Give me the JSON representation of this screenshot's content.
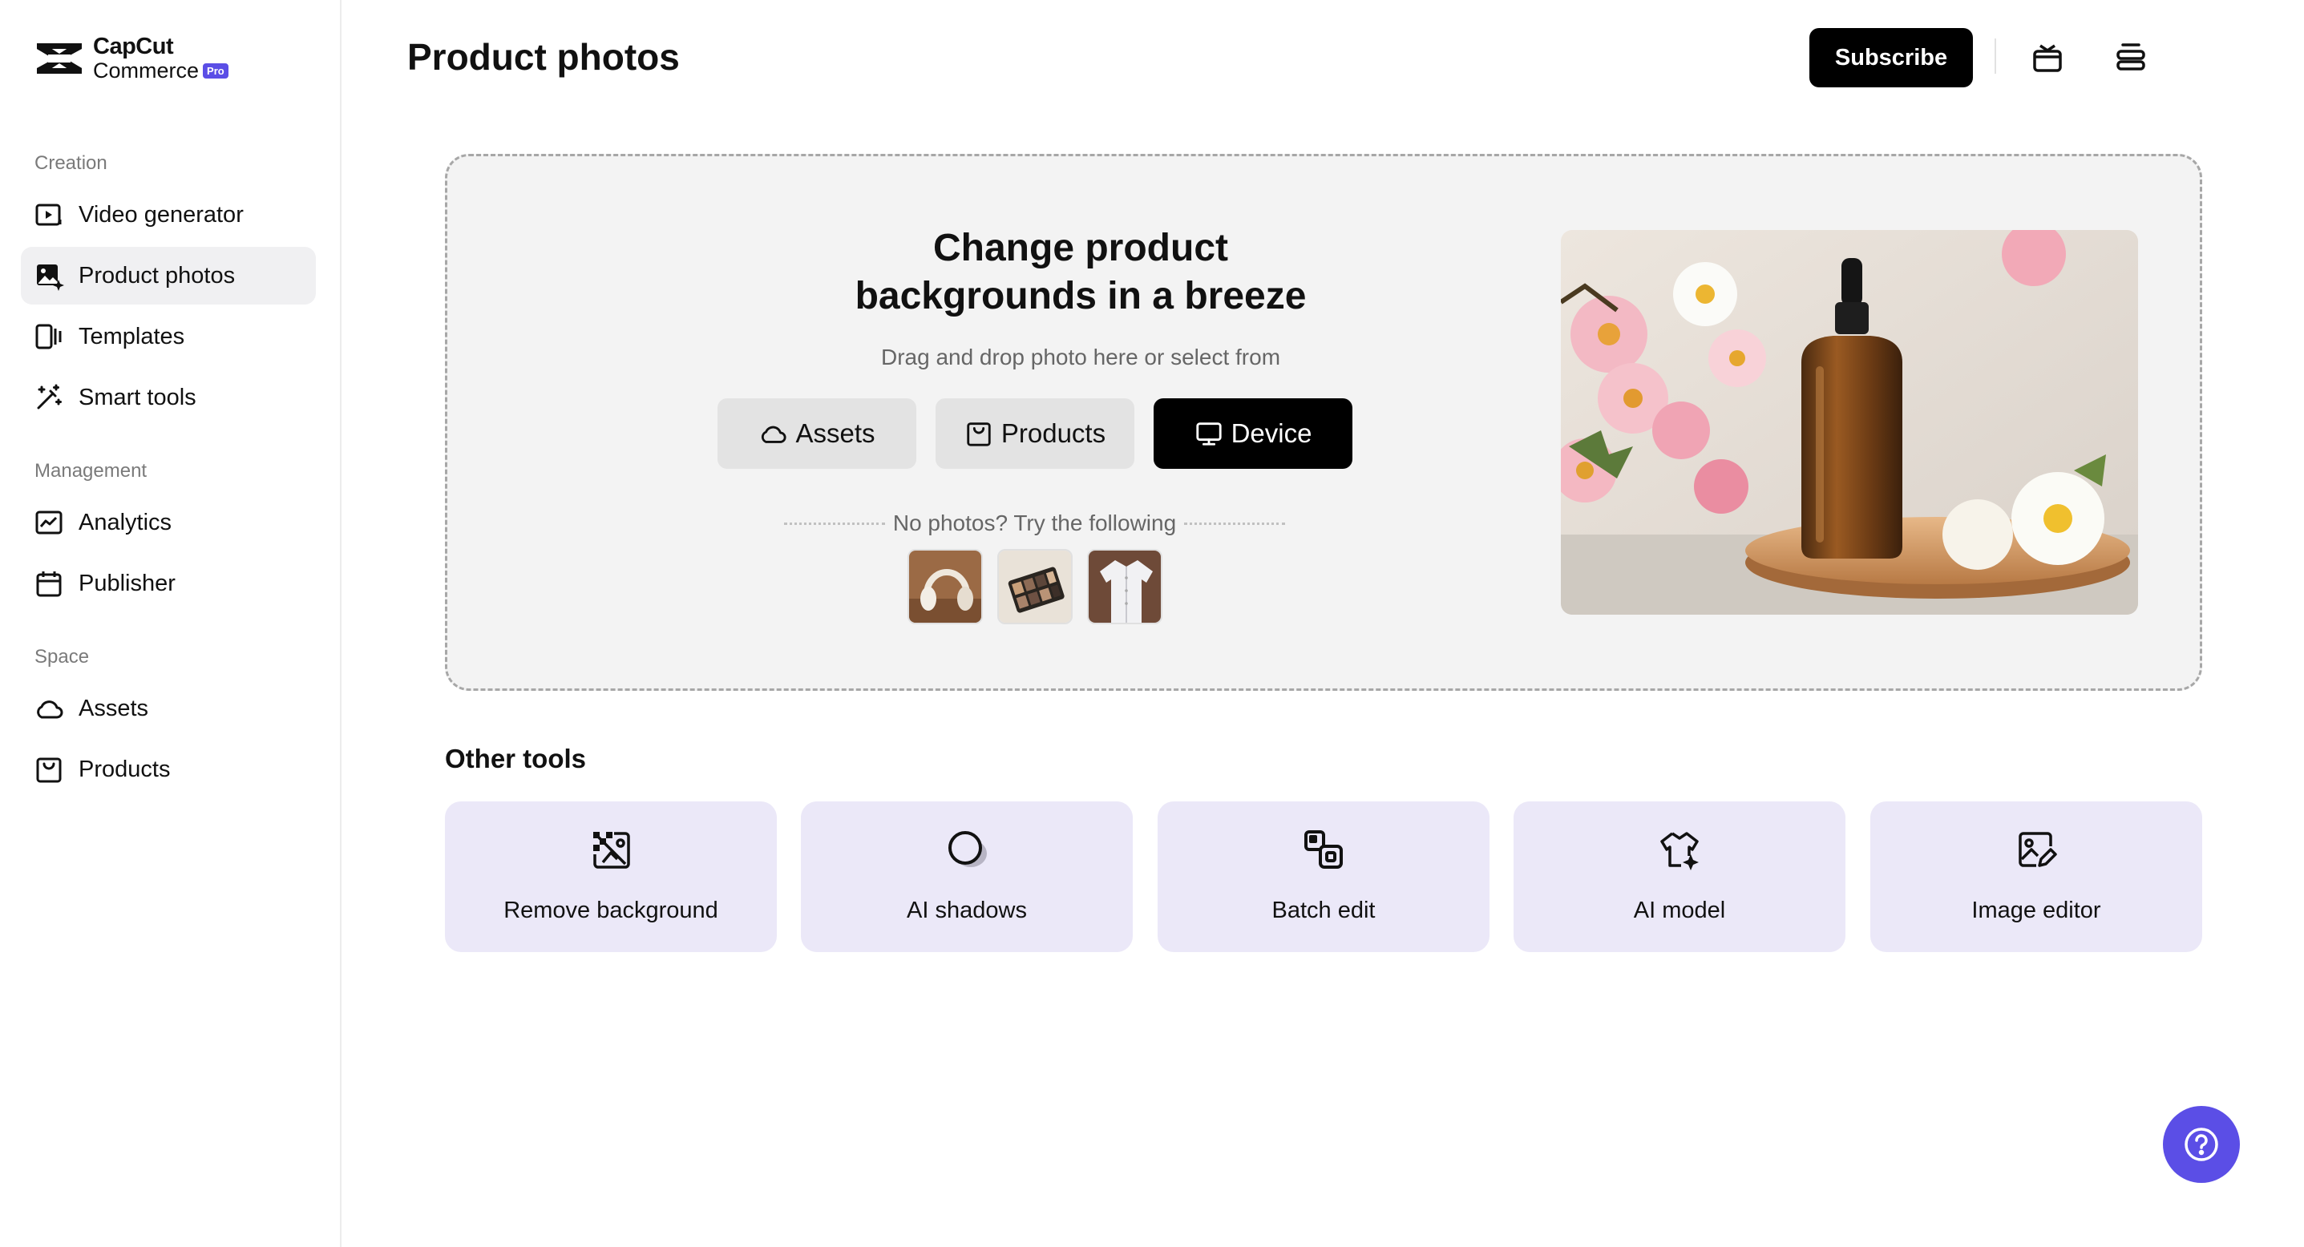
{
  "brand": {
    "name_line1": "CapCut",
    "name_line2": "Commerce",
    "badge": "Pro",
    "accent": "#5b4ee6"
  },
  "sidebar": {
    "sections": [
      {
        "label": "Creation"
      },
      {
        "label": "Management"
      },
      {
        "label": "Space"
      }
    ],
    "items": [
      {
        "label": "Video generator",
        "icon": "video-generator-icon",
        "active": false
      },
      {
        "label": "Product photos",
        "icon": "product-photos-icon",
        "active": true
      },
      {
        "label": "Templates",
        "icon": "templates-icon",
        "active": false
      },
      {
        "label": "Smart tools",
        "icon": "magic-wand-icon",
        "active": false
      },
      {
        "label": "Analytics",
        "icon": "analytics-icon",
        "active": false
      },
      {
        "label": "Publisher",
        "icon": "calendar-icon",
        "active": false
      },
      {
        "label": "Assets",
        "icon": "cloud-icon",
        "active": false
      },
      {
        "label": "Products",
        "icon": "bag-icon",
        "active": false
      }
    ]
  },
  "header": {
    "title": "Product photos",
    "subscribe_label": "Subscribe",
    "icons": [
      "gift-icon",
      "stack-icon"
    ]
  },
  "upload": {
    "title_line1": "Change product",
    "title_line2": "backgrounds in a breeze",
    "subtitle": "Drag and drop photo here or select from",
    "sources": [
      {
        "label": "Assets",
        "icon": "cloud-icon"
      },
      {
        "label": "Products",
        "icon": "bag-icon"
      },
      {
        "label": "Device",
        "icon": "monitor-icon"
      }
    ],
    "try_text": "No photos? Try the following",
    "samples": [
      "headphones",
      "eyeshadow palette",
      "white shirt"
    ]
  },
  "other_tools": {
    "title": "Other tools",
    "tools": [
      {
        "label": "Remove background",
        "icon": "remove-background-icon"
      },
      {
        "label": "AI shadows",
        "icon": "ai-shadows-icon"
      },
      {
        "label": "Batch edit",
        "icon": "batch-edit-icon"
      },
      {
        "label": "AI model",
        "icon": "ai-model-icon"
      },
      {
        "label": "Image editor",
        "icon": "image-editor-icon"
      }
    ]
  },
  "help": {
    "icon": "help-icon"
  }
}
